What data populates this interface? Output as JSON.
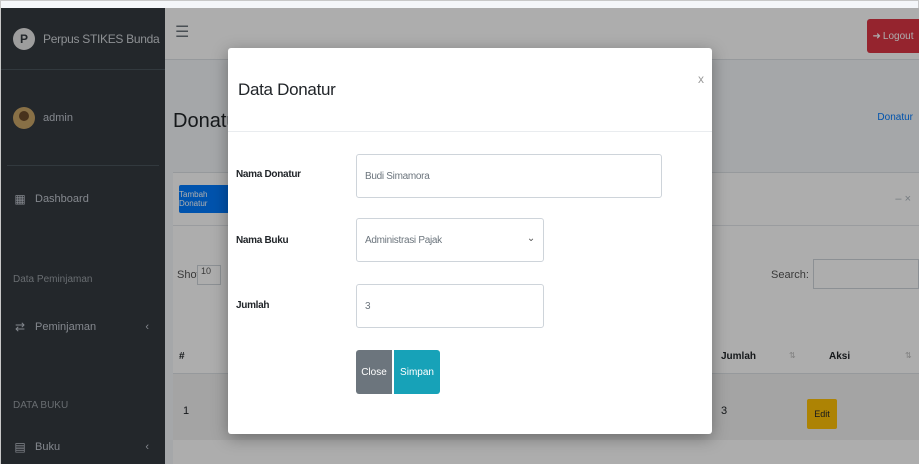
{
  "brand": {
    "logo_letter": "P",
    "name": "Perpus STIKES Bunda"
  },
  "user": {
    "name": "admin"
  },
  "sidebar": {
    "items": [
      {
        "type": "link",
        "icon": "dashboard-icon",
        "glyph": "▦",
        "label": "Dashboard"
      },
      {
        "type": "header",
        "label": "Data Peminjaman"
      },
      {
        "type": "link",
        "icon": "exchange-icon",
        "glyph": "⇄",
        "label": "Peminjaman",
        "has_chevron": true
      },
      {
        "type": "header",
        "label": "DATA BUKU"
      },
      {
        "type": "link",
        "icon": "book-icon",
        "glyph": "▤",
        "label": "Buku",
        "has_chevron": true
      }
    ],
    "chevron": "‹"
  },
  "topbar": {
    "menu_glyph": "☰",
    "logout_label": "Logout",
    "logout_glyph": "➜"
  },
  "page": {
    "title": "Donatur",
    "breadcrumb": "Donatur",
    "add_button": "Tambah Donatur",
    "card_tools": "–  ×",
    "show_label": "Show",
    "show_value": "10",
    "search_label": "Search:",
    "table": {
      "headers": [
        "#",
        "Jumlah",
        "Aksi"
      ],
      "rows": [
        {
          "no": "1",
          "jumlah": "3",
          "action": "Edit"
        }
      ]
    }
  },
  "modal": {
    "title": "Data Donatur",
    "close_glyph": "x",
    "fields": [
      {
        "label": "Nama Donatur",
        "value": "Budi Simamora",
        "kind": "input"
      },
      {
        "label": "Nama Buku",
        "value": "Administrasi Pajak",
        "kind": "select"
      },
      {
        "label": "Jumlah",
        "value": "3",
        "kind": "input"
      }
    ],
    "select_arrow": "⌄",
    "close_button": "Close",
    "save_button": "Simpan"
  },
  "colors": {
    "sidebar": "#343a40",
    "primary": "#007bff",
    "danger": "#dc3545",
    "info": "#17a2b8",
    "secondary": "#6c757d",
    "warning": "#ffc107"
  }
}
